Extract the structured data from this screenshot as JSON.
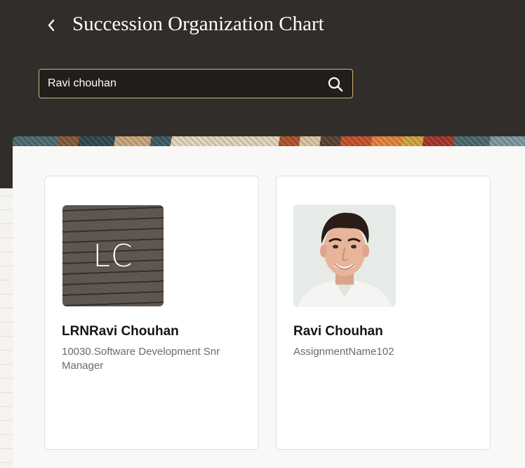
{
  "header": {
    "title": "Succession Organization Chart",
    "back_icon": "chevron-left-icon"
  },
  "search": {
    "value": "Ravi chouhan",
    "icon": "search-icon"
  },
  "cards": [
    {
      "initials": "LC",
      "name": "LRNRavi Chouhan",
      "job": "10030.Software Development Snr Manager"
    },
    {
      "photo": "person-photo",
      "name": "Ravi Chouhan",
      "job": "AssignmentName102"
    }
  ],
  "colors": {
    "header_bg": "#312d2a",
    "search_border": "#d6b878",
    "card_bg": "#ffffff"
  }
}
